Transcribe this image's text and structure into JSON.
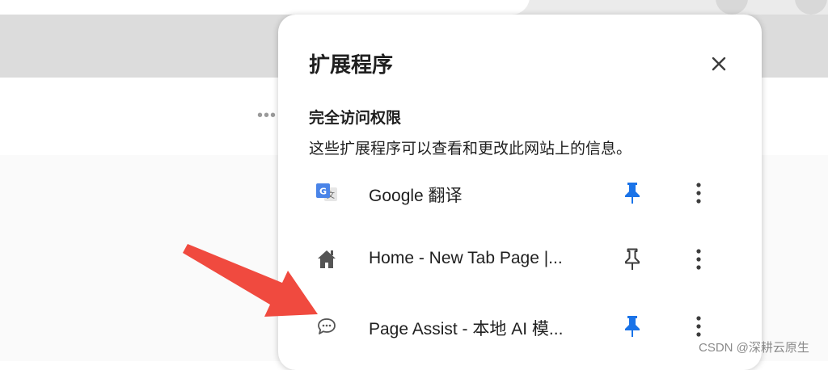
{
  "popup": {
    "title": "扩展程序",
    "section_title": "完全访问权限",
    "section_desc": "这些扩展程序可以查看和更改此网站上的信息。",
    "extensions": [
      {
        "name": "Google 翻译",
        "icon": "google-translate-icon",
        "pinned": true
      },
      {
        "name": "Home - New Tab Page |...",
        "icon": "home-icon",
        "pinned": false
      },
      {
        "name": "Page Assist - 本地 AI 模...",
        "icon": "chat-bubble-icon",
        "pinned": true
      }
    ]
  },
  "background": {
    "more_dots": "•••"
  },
  "colors": {
    "accent": "#1a73e8",
    "annotation_arrow": "#f04a3f"
  },
  "watermark": "CSDN @深耕云原生"
}
